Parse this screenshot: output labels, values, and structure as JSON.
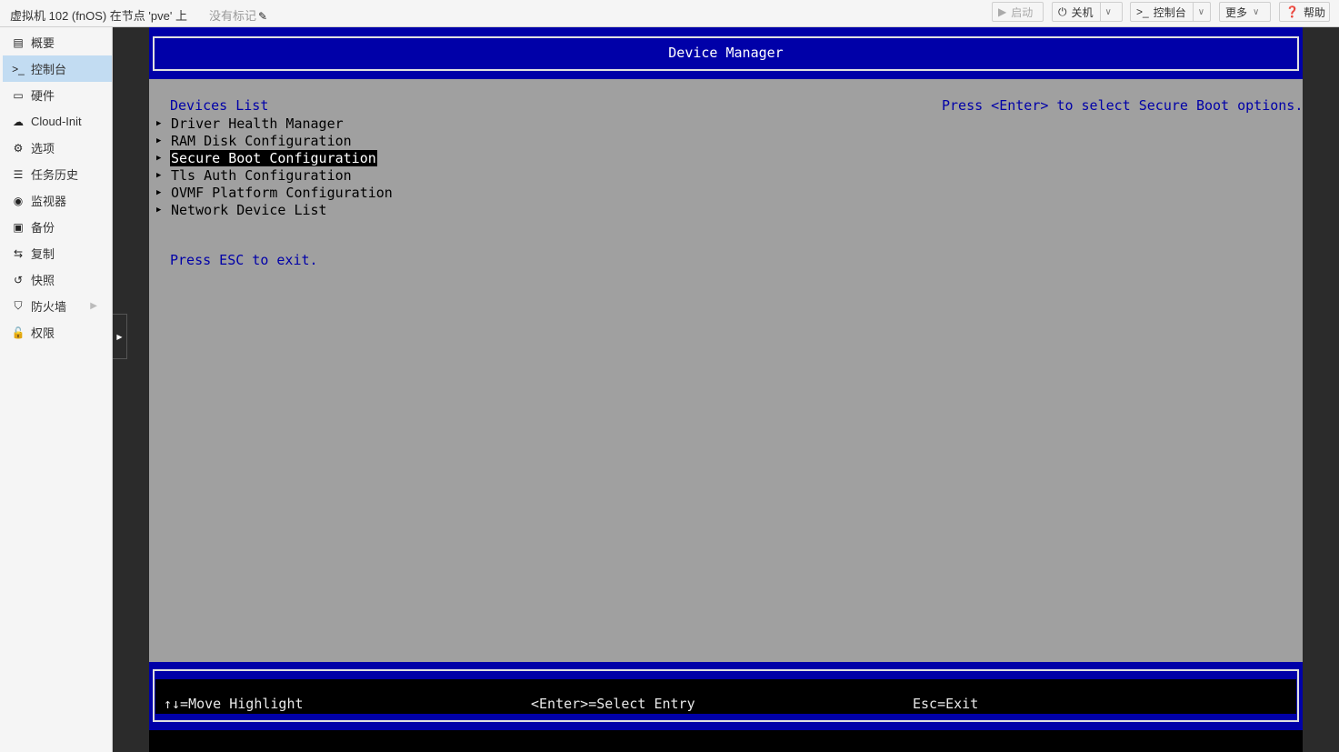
{
  "header": {
    "vm_title": "虚拟机 102 (fnOS) 在节点 'pve' 上",
    "tags_label": "没有标记",
    "buttons": {
      "start": "启动",
      "shutdown": "关机",
      "console": "控制台",
      "more": "更多",
      "help": "帮助"
    }
  },
  "sidebar": {
    "items": [
      {
        "label": "概要",
        "icon": "book-icon"
      },
      {
        "label": "控制台",
        "icon": "terminal-icon"
      },
      {
        "label": "硬件",
        "icon": "monitor-icon"
      },
      {
        "label": "Cloud-Init",
        "icon": "cloud-icon"
      },
      {
        "label": "选项",
        "icon": "gear-icon"
      },
      {
        "label": "任务历史",
        "icon": "list-icon"
      },
      {
        "label": "监视器",
        "icon": "eye-icon"
      },
      {
        "label": "备份",
        "icon": "floppy-icon"
      },
      {
        "label": "复制",
        "icon": "retweet-icon"
      },
      {
        "label": "快照",
        "icon": "history-icon"
      },
      {
        "label": "防火墙",
        "icon": "shield-icon"
      },
      {
        "label": "权限",
        "icon": "unlock-icon"
      }
    ],
    "active_index": 1
  },
  "bios": {
    "title": "Device Manager",
    "devices_list_label": "Devices List",
    "menu_items": [
      "Driver Health Manager",
      "RAM Disk Configuration",
      "Secure Boot Configuration",
      "Tls Auth Configuration",
      "OVMF Platform Configuration",
      "Network Device List"
    ],
    "selected_index": 2,
    "help_text": "Press <Enter> to select Secure Boot options.",
    "esc_text": "Press ESC to exit.",
    "footer": {
      "move": "↑↓=Move Highlight",
      "select": "<Enter>=Select Entry",
      "exit": "Esc=Exit"
    },
    "colors": {
      "bios_blue": "#0000a8",
      "bios_gray": "#a0a0a0",
      "selection_bg": "#000000",
      "sidebar_active": "#c2dcf2"
    }
  }
}
